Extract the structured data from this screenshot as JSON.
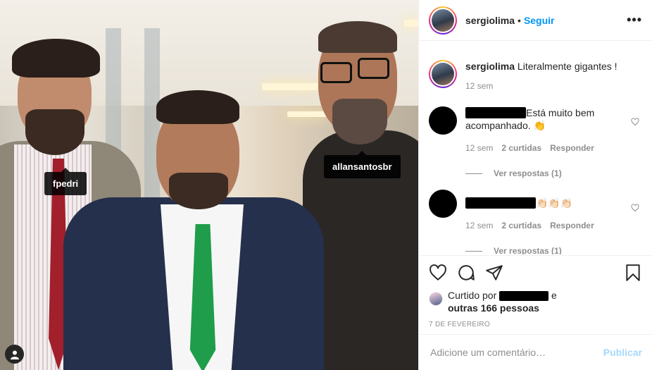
{
  "post": {
    "author": "sergiolima",
    "follow_label": "Seguir",
    "dot": "•",
    "more_label": "•••",
    "photo_tags": [
      "fpedri",
      "allansantosbr"
    ]
  },
  "caption": {
    "username": "sergiolima",
    "text": "Literalmente gigantes !",
    "time": "12 sem"
  },
  "comments": [
    {
      "text": "Está muito bem acompanhado. 👏",
      "time": "12 sem",
      "likes": "2 curtidas",
      "reply_label": "Responder",
      "view_replies": "Ver respostas (1)"
    },
    {
      "text": "👏🏻👏🏻👏🏻",
      "time": "12 sem",
      "likes": "2 curtidas",
      "reply_label": "Responder",
      "view_replies": "Ver respostas (1)"
    }
  ],
  "likes": {
    "prefix": "Curtido por",
    "suffix": "e",
    "others": "outras 166 pessoas"
  },
  "date": "7 DE FEVEREIRO",
  "add_comment": {
    "placeholder": "Adicione um comentário…",
    "publish_label": "Publicar"
  },
  "colors": {
    "link": "#0095f6",
    "muted": "#8e8e8e",
    "text": "#262626",
    "tie_green": "#1f9d4a",
    "tie_red": "#a2202c"
  },
  "icons": [
    "heart-icon",
    "comment-icon",
    "share-icon",
    "bookmark-icon",
    "user-tag-icon",
    "more-icon"
  ]
}
